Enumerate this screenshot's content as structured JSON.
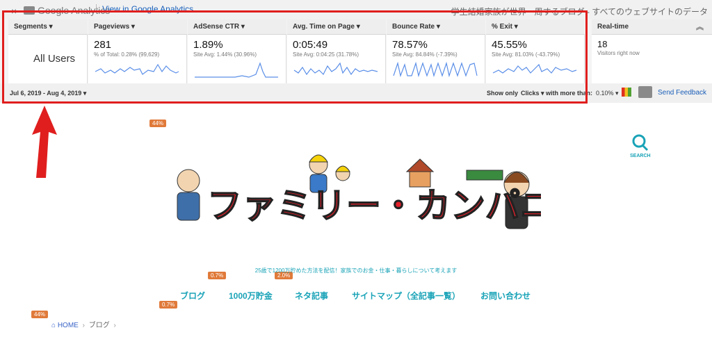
{
  "ga_bar": {
    "close": "×",
    "logo": "Google Analytics",
    "view_link": "View in Google Analytics",
    "site_name": "学生結婚家族が世界一周するブログ - すべてのウェブサイトのデータ"
  },
  "metrics": {
    "segments_header": "Segments",
    "segment_value": "All Users",
    "pageviews": {
      "label": "Pageviews",
      "value": "281",
      "sub": "% of Total: 0.28% (99,629)"
    },
    "ctr": {
      "label": "AdSense CTR",
      "value": "1.89%",
      "sub": "Site Avg: 1.44% (30.96%)"
    },
    "time": {
      "label": "Avg. Time on Page",
      "value": "0:05:49",
      "sub": "Site Avg: 0:04:25 (31.78%)"
    },
    "bounce": {
      "label": "Bounce Rate",
      "value": "78.57%",
      "sub": "Site Avg: 84.84% (-7.39%)"
    },
    "exit": {
      "label": "% Exit",
      "value": "45.55%",
      "sub": "Site Avg: 81.03% (-43.79%)"
    },
    "realtime": {
      "label": "Real-time",
      "value": "18",
      "sub": "Visitors right now"
    }
  },
  "footer": {
    "date_range": "Jul 6, 2019 - Aug 4, 2019",
    "show_only": "Show only",
    "clicks": "Clicks",
    "more_than": "with more than:",
    "threshold": "0.10%",
    "send_feedback": "Send Feedback"
  },
  "badges": {
    "b1": "44%",
    "b2": "0.7%",
    "b3": "2.0%",
    "b4": "0.7%",
    "b5": "44%"
  },
  "search_label": "SEARCH",
  "banner_title": "ファミリー・カンパニー",
  "tagline": "25歳で1200万貯めた方法を配信！家族でのお金・仕事・暮らしについて考えます",
  "nav": [
    "ブログ",
    "1000万貯金",
    "ネタ記事",
    "サイトマップ（全記事一覧）",
    "お問い合わせ"
  ],
  "breadcrumb": {
    "home": "HOME",
    "current": "ブログ"
  },
  "colors": {
    "accent": "#19a3b7",
    "frame": "#e01e1e",
    "badge": "#e07a3a",
    "spark": "#5b8fe8"
  }
}
